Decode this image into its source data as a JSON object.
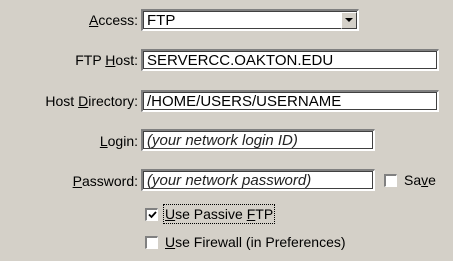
{
  "form": {
    "access": {
      "label_pre": "",
      "label_key": "A",
      "label_post": "ccess:",
      "value": "FTP",
      "icon": "chevron-down-icon"
    },
    "ftp_host": {
      "label_pre": "FTP ",
      "label_key": "H",
      "label_post": "ost:",
      "value": "SERVERCC.OAKTON.EDU"
    },
    "host_directory": {
      "label_pre": "Host ",
      "label_key": "D",
      "label_post": "irectory:",
      "value": "/HOME/USERS/USERNAME"
    },
    "login": {
      "label_pre": "",
      "label_key": "L",
      "label_post": "ogin:",
      "placeholder": "(your network login ID)"
    },
    "password": {
      "label_pre": "",
      "label_key": "P",
      "label_post": "assword:",
      "placeholder": "(your network password)"
    },
    "save": {
      "label_pre": "Sa",
      "label_key": "v",
      "label_post": "e",
      "checked": false
    },
    "use_passive_ftp": {
      "label_pre": "",
      "label_key": "U",
      "label_mid": "se Passive ",
      "label_key2": "F",
      "label_post": "TP",
      "checked": true
    },
    "use_firewall": {
      "label_pre": "",
      "label_key": "U",
      "label_post": "se Firewall (in Preferences)",
      "checked": false
    }
  }
}
